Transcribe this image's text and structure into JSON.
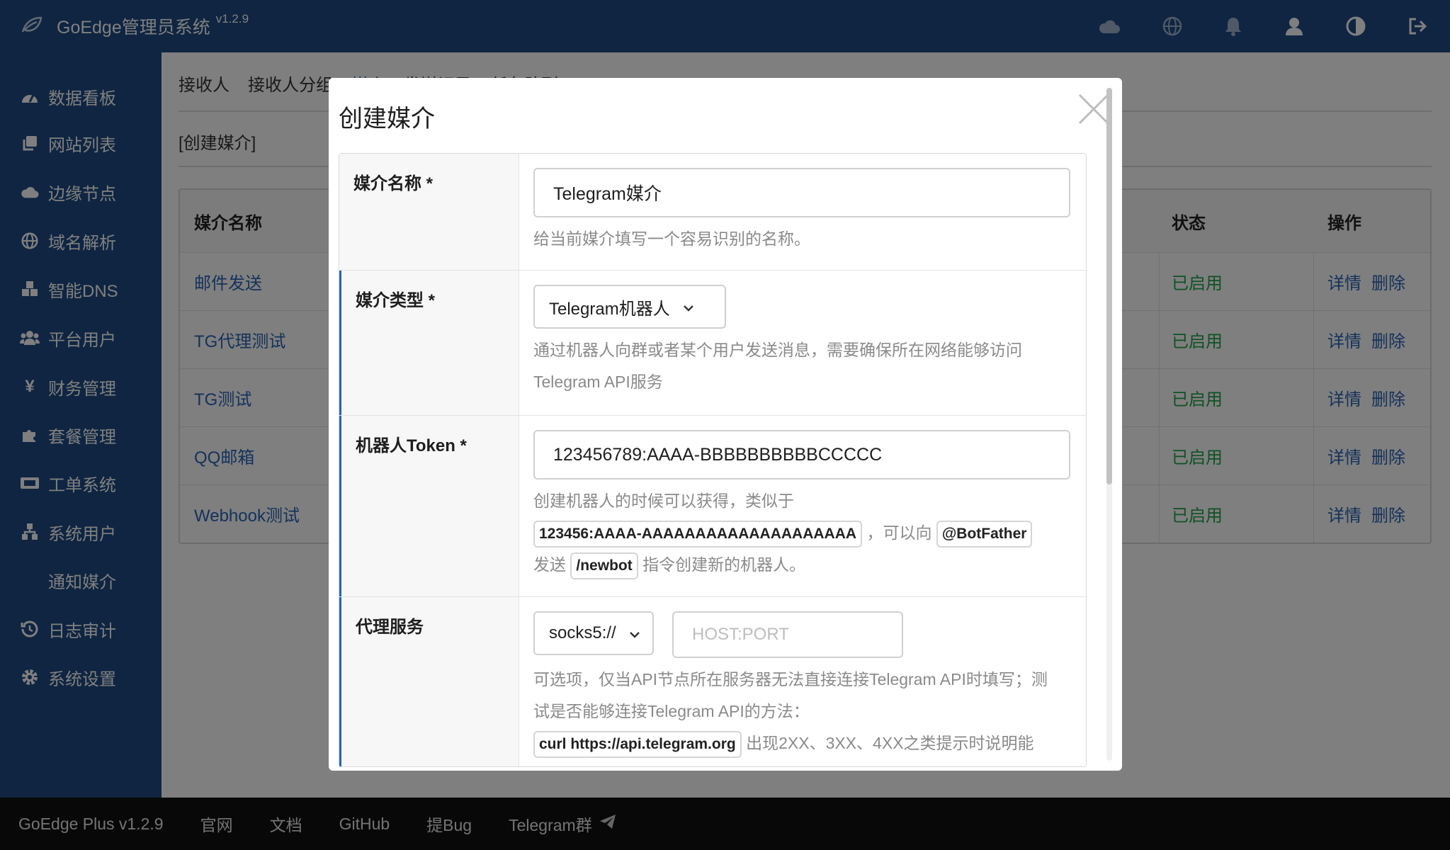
{
  "app": {
    "title": "GoEdge管理员系统",
    "version": "v1.2.9"
  },
  "topbar": {
    "icons": [
      "cloud-icon",
      "globe-icon",
      "bell-icon",
      "user-icon",
      "contrast-icon",
      "logout-icon"
    ]
  },
  "sidebar": {
    "items": [
      {
        "label": "数据看板",
        "icon": "dashboard-icon"
      },
      {
        "label": "网站列表",
        "icon": "copy-icon"
      },
      {
        "label": "边缘节点",
        "icon": "cloud-icon"
      },
      {
        "label": "域名解析",
        "icon": "globe-icon"
      },
      {
        "label": "智能DNS",
        "icon": "cubes-icon"
      },
      {
        "label": "平台用户",
        "icon": "users-icon"
      },
      {
        "label": "财务管理",
        "icon": "yen-icon"
      },
      {
        "label": "套餐管理",
        "icon": "puzzle-icon"
      },
      {
        "label": "工单系统",
        "icon": "ticket-icon"
      },
      {
        "label": "系统用户",
        "icon": "sitemap-icon"
      },
      {
        "label": "通知媒介",
        "icon": ""
      },
      {
        "label": "日志审计",
        "icon": "history-icon"
      },
      {
        "label": "系统设置",
        "icon": "gear-icon"
      }
    ]
  },
  "main": {
    "tabs": [
      "接收人",
      "接收人分组",
      "媒介",
      "发送记录",
      "任务队列"
    ],
    "subhead": "[创建媒介]",
    "table": {
      "headers": {
        "name": "媒介名称",
        "status": "状态",
        "ops": "操作"
      },
      "rows": [
        {
          "name": "邮件发送",
          "status": "已启用",
          "op1": "详情",
          "op2": "删除"
        },
        {
          "name": "TG代理测试",
          "status": "已启用",
          "op1": "详情",
          "op2": "删除"
        },
        {
          "name": "TG测试",
          "status": "已启用",
          "op1": "详情",
          "op2": "删除"
        },
        {
          "name": "QQ邮箱",
          "status": "已启用",
          "op1": "详情",
          "op2": "删除"
        },
        {
          "name": "Webhook测试",
          "status": "已启用",
          "op1": "详情",
          "op2": "删除"
        }
      ]
    }
  },
  "modal": {
    "title": "创建媒介",
    "fields": {
      "name": {
        "label": "媒介名称 *",
        "value": "Telegram媒介",
        "hint": "给当前媒介填写一个容易识别的名称。"
      },
      "type": {
        "label": "媒介类型 *",
        "value": "Telegram机器人",
        "hint": "通过机器人向群或者某个用户发送消息，需要确保所在网络能够访问Telegram API服务"
      },
      "token": {
        "label": "机器人Token *",
        "value": "123456789:AAAA-BBBBBBBBBBCCCCC",
        "hint_pre": "创建机器人的时候可以获得，类似于",
        "hint_code1": "123456:AAAA-AAAAAAAAAAAAAAAAAAAA",
        "hint_mid": "，可以向",
        "hint_code2": "@BotFather",
        "hint_mid2": "发送",
        "hint_code3": "/newbot",
        "hint_post": "指令创建新的机器人。"
      },
      "proxy": {
        "label": "代理服务",
        "scheme": "socks5://",
        "placeholder": "HOST:PORT",
        "hint_pre": "可选项，仅当API节点所在服务器无法直接连接Telegram API时填写；测试是否能够连接Telegram API的方法：",
        "hint_code": "curl https://api.telegram.org",
        "hint_post": "出现2XX、3XX、4XX之类提示时说明能"
      }
    }
  },
  "footer": {
    "items": [
      "GoEdge Plus v1.2.9",
      "官网",
      "文档",
      "GitHub",
      "提Bug",
      "Telegram群"
    ]
  },
  "colors": {
    "brand": "#1f4b85",
    "link": "#2a64b6",
    "enabled": "#21a24b",
    "footer": "#111111"
  }
}
